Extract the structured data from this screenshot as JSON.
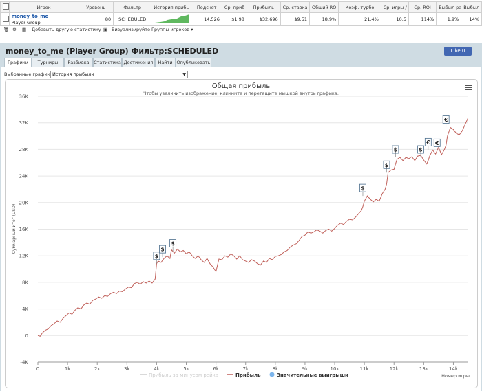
{
  "table": {
    "headers": [
      "",
      "Игрок",
      "Уровень",
      "Фильтр",
      "История прибы",
      "Подсчет",
      "Ср. приб",
      "Прибыль",
      "Ср. ставка",
      "Общий ROI",
      "Коэф. турбо",
      "Ср. игры / ...",
      "Ср. ROI",
      "Выбыл рано",
      "Выбыл п"
    ],
    "row": {
      "player_name": "money_to_me",
      "player_group": "Player Group",
      "level": "80",
      "filter": "SCHEDULED",
      "count": "14,526",
      "avg_profit": "$1.98",
      "profit": "$32,696",
      "avg_stake": "$9.51",
      "total_roi": "18.9%",
      "turbo_ratio": "21.4%",
      "avg_games": "10.5",
      "avg_roi": "114%",
      "early_out": "1.9%",
      "late_out": "14%"
    }
  },
  "toolbar": {
    "add_stats": "Добавить другую статистику",
    "visualize": "Визуализируйте",
    "player_groups": "Группы игроков ▾"
  },
  "panel": {
    "title": "money_to_me (Player Group) Фильтр:SCHEDULED",
    "like": "Like 0"
  },
  "tabs": [
    "Графики",
    "Турниры",
    "Разбивка",
    "Статистика",
    "Достижения",
    "Найти",
    "Опубликовать"
  ],
  "select": {
    "label": "Выбранные графики:",
    "value": "История прибыли"
  },
  "chart_data": {
    "type": "line",
    "title": "Общая прибыль",
    "subtitle": "Чтобы увеличить изображение, кликните и перетащите мышкой внутрь графика.",
    "xlabel": "Номер игры",
    "ylabel": "Суммарный итог (USD)",
    "xlim": [
      0,
      14500
    ],
    "ylim": [
      -4000,
      36000
    ],
    "x_ticks": [
      "0",
      "1k",
      "2k",
      "3k",
      "4k",
      "5k",
      "6k",
      "7k",
      "8k",
      "9k",
      "10k",
      "11k",
      "12k",
      "13k",
      "14k"
    ],
    "y_ticks": [
      "-4K",
      "0",
      "4K",
      "8K",
      "12K",
      "16K",
      "20K",
      "24K",
      "28K",
      "32K",
      "36K"
    ],
    "legend": [
      "Прибыль за минусом рейка",
      "Прибыль",
      "Значительные выигрыши"
    ],
    "legend_position": "bottom",
    "colors": {
      "line": "#c0605a",
      "legend_muted": "#cccccc",
      "win_marker": "#7cb5ec",
      "grid": "#e6e6e6"
    },
    "series": [
      {
        "name": "Прибыль",
        "x": [
          0,
          80,
          150,
          250,
          350,
          450,
          550,
          650,
          750,
          850,
          950,
          1050,
          1150,
          1250,
          1350,
          1450,
          1550,
          1650,
          1750,
          1850,
          1950,
          2050,
          2150,
          2250,
          2350,
          2450,
          2550,
          2650,
          2750,
          2850,
          2950,
          3050,
          3150,
          3250,
          3350,
          3450,
          3550,
          3650,
          3750,
          3850,
          3950,
          4000,
          4050,
          4150,
          4250,
          4350,
          4450,
          4500,
          4600,
          4700,
          4800,
          4900,
          5000,
          5100,
          5200,
          5300,
          5400,
          5500,
          5600,
          5700,
          5800,
          5900,
          6000,
          6100,
          6200,
          6300,
          6400,
          6500,
          6600,
          6700,
          6800,
          6900,
          7000,
          7100,
          7200,
          7300,
          7400,
          7500,
          7600,
          7700,
          7800,
          7900,
          8000,
          8100,
          8200,
          8300,
          8400,
          8500,
          8600,
          8700,
          8800,
          8900,
          9000,
          9100,
          9200,
          9300,
          9400,
          9500,
          9600,
          9700,
          9800,
          9900,
          10000,
          10100,
          10200,
          10300,
          10400,
          10500,
          10600,
          10700,
          10800,
          10900,
          10950,
          11000,
          11100,
          11200,
          11300,
          11400,
          11500,
          11600,
          11700,
          11750,
          11800,
          11900,
          12000,
          12050,
          12100,
          12200,
          12300,
          12400,
          12500,
          12600,
          12700,
          12800,
          12900,
          13000,
          13100,
          13150,
          13200,
          13300,
          13400,
          13500,
          13600,
          13700,
          13750,
          13800,
          13900,
          14000,
          14100,
          14200,
          14300,
          14400,
          14500
        ],
        "values": [
          0,
          -100,
          400,
          800,
          1000,
          1500,
          1800,
          2200,
          2000,
          2600,
          3000,
          3400,
          3200,
          3800,
          4200,
          4000,
          4600,
          4900,
          4700,
          5300,
          5500,
          5800,
          5600,
          6000,
          5900,
          6300,
          6500,
          6300,
          6700,
          6600,
          7000,
          7300,
          7200,
          7800,
          8000,
          7700,
          8100,
          7900,
          8200,
          7900,
          8500,
          10800,
          11200,
          11000,
          11600,
          12000,
          11600,
          12900,
          12400,
          13000,
          12600,
          12800,
          12300,
          12600,
          12000,
          11600,
          12000,
          11400,
          11000,
          11600,
          10800,
          10300,
          9600,
          11500,
          11400,
          12000,
          11800,
          12300,
          12000,
          11500,
          12000,
          11400,
          11200,
          11000,
          11400,
          11200,
          10800,
          10600,
          11200,
          11000,
          11600,
          11400,
          11900,
          12000,
          12200,
          12600,
          12800,
          13300,
          13600,
          13800,
          14300,
          14900,
          15100,
          15600,
          15400,
          15600,
          15900,
          15700,
          15400,
          15800,
          16000,
          15700,
          16100,
          16600,
          16900,
          16700,
          17200,
          17500,
          17400,
          17800,
          18300,
          18800,
          19400,
          20200,
          21000,
          20500,
          20100,
          20500,
          20200,
          21300,
          22000,
          22800,
          24500,
          24900,
          25000,
          25800,
          26500,
          26800,
          26300,
          26800,
          26600,
          26900,
          26300,
          27000,
          27100,
          26400,
          25800,
          26300,
          27000,
          27900,
          27300,
          28300,
          27200,
          28000,
          28600,
          30000,
          31300,
          31000,
          30400,
          30200,
          30800,
          31800,
          32800
        ]
      }
    ],
    "big_wins": [
      {
        "x": 4000,
        "y": 10800,
        "label": "$"
      },
      {
        "x": 4200,
        "y": 11800,
        "label": "$"
      },
      {
        "x": 4550,
        "y": 12700,
        "label": "$"
      },
      {
        "x": 10950,
        "y": 21000,
        "label": "$"
      },
      {
        "x": 11750,
        "y": 24500,
        "label": "$"
      },
      {
        "x": 12050,
        "y": 26800,
        "label": "$"
      },
      {
        "x": 12900,
        "y": 26800,
        "label": "$"
      },
      {
        "x": 13150,
        "y": 27900,
        "label": "€"
      },
      {
        "x": 13450,
        "y": 27800,
        "label": "€"
      },
      {
        "x": 13750,
        "y": 31300,
        "label": "€"
      }
    ]
  }
}
